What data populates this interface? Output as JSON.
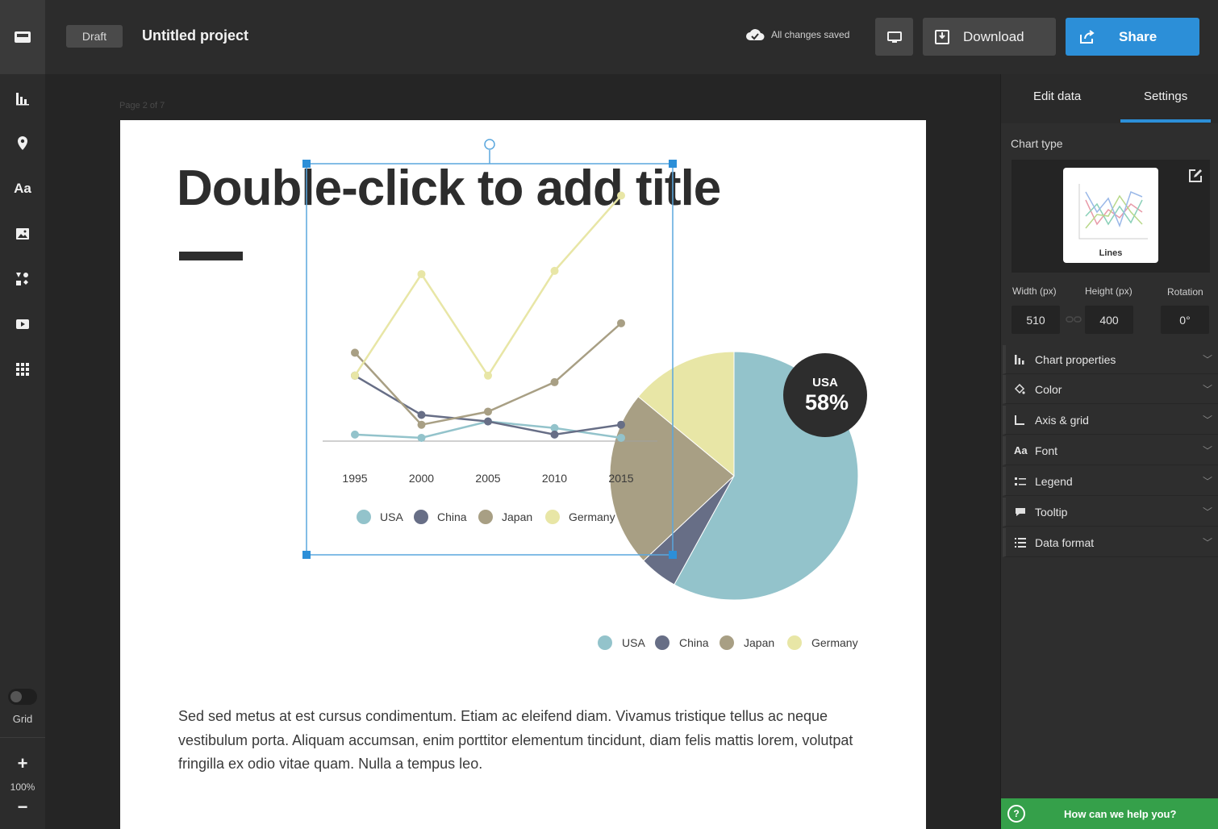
{
  "topbar": {
    "draft_label": "Draft",
    "project_title": "Untitled project",
    "saved_status": "All changes saved",
    "download_label": "Download",
    "share_label": "Share"
  },
  "sidebar": {
    "items": [
      {
        "icon": "charts-icon"
      },
      {
        "icon": "map-icon"
      },
      {
        "icon": "text-icon",
        "label": "Aa"
      },
      {
        "icon": "image-icon"
      },
      {
        "icon": "shapes-icon"
      },
      {
        "icon": "video-icon"
      },
      {
        "icon": "apps-grid-icon"
      }
    ],
    "grid_label": "Grid",
    "zoom_plus": "+",
    "zoom_value": "100%",
    "zoom_minus": "−"
  },
  "canvas": {
    "page_indicator": "Page 2 of 7",
    "placeholder_title": "Double-click to add title",
    "body_text": "Sed sed metus at est cursus condimentum. Etiam ac eleifend diam. Vivamus tristique tellus ac neque vestibulum porta. Aliquam accumsan, enim porttitor elementum tincidunt, diam felis mattis lorem, volutpat fringilla ex odio vitae quam. Nulla a tempus leo."
  },
  "colors": {
    "accent": "#2c8fd8",
    "help_green": "#35a04a",
    "usa": "#93c3cb",
    "china": "#676e86",
    "japan": "#a89f84",
    "germany": "#e8e6a6"
  },
  "chart_data": [
    {
      "type": "line",
      "x": [
        "1995",
        "2000",
        "2005",
        "2010",
        "2015"
      ],
      "series": [
        {
          "name": "USA",
          "values": [
            2,
            1,
            6,
            4,
            1
          ]
        },
        {
          "name": "China",
          "values": [
            20,
            8,
            6,
            2,
            5
          ]
        },
        {
          "name": "Japan",
          "values": [
            27,
            5,
            9,
            18,
            36
          ]
        },
        {
          "name": "Germany",
          "values": [
            20,
            51,
            20,
            52,
            75
          ]
        }
      ],
      "legend": "bottom"
    },
    {
      "type": "pie",
      "slices": [
        {
          "name": "USA",
          "value": 58
        },
        {
          "name": "China",
          "value": 5
        },
        {
          "name": "Japan",
          "value": 23
        },
        {
          "name": "Germany",
          "value": 14
        }
      ],
      "callout": {
        "label": "USA",
        "value": "58%"
      },
      "legend": "bottom"
    }
  ],
  "panel": {
    "tab_edit": "Edit data",
    "tab_settings": "Settings",
    "chart_type_label": "Chart type",
    "chart_type_value": "Lines",
    "width_label": "Width (px)",
    "width_value": "510",
    "height_label": "Height (px)",
    "height_value": "400",
    "rotation_label": "Rotation",
    "rotation_value": "0°",
    "sections": [
      "Chart properties",
      "Color",
      "Axis & grid",
      "Font",
      "Legend",
      "Tooltip",
      "Data format"
    ],
    "help_label": "How can we help you?"
  }
}
